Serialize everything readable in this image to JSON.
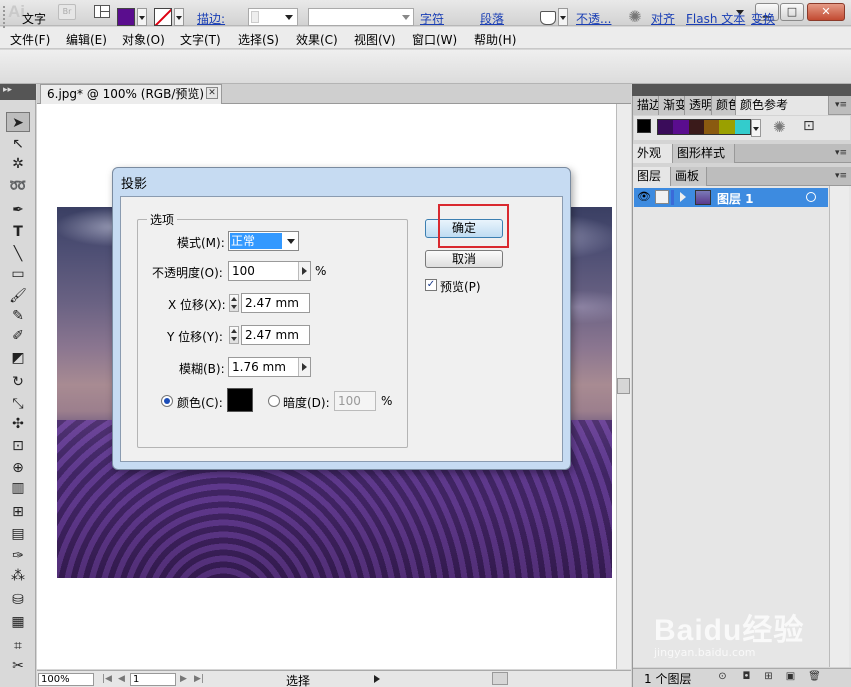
{
  "app": {
    "logo": "Ai",
    "bridge": "Br"
  },
  "window": {
    "minimize": "▁",
    "maximize": "□",
    "close": "✕"
  },
  "menu": [
    "文件(F)",
    "编辑(E)",
    "对象(O)",
    "文字(T)",
    "选择(S)",
    "效果(C)",
    "视图(V)",
    "窗口(W)",
    "帮助(H)"
  ],
  "control_bar": {
    "type_label": "文字",
    "stroke_label": "描边:",
    "fill_color": "#5a0d8e",
    "links": [
      "字符",
      "段落",
      "不透...",
      "对齐",
      "Flash 文本",
      "变换"
    ]
  },
  "document": {
    "tab_title": "6.jpg* @ 100% (RGB/预览)",
    "tab_close": "✕"
  },
  "status_bar": {
    "zoom": "100%",
    "page": "1",
    "status": "选择"
  },
  "right_panel": {
    "tabs_top": [
      "描边",
      "渐变",
      "透明",
      "颜色",
      "颜色参考"
    ],
    "tabs_mid": [
      "外观",
      "图形样式"
    ],
    "tabs_layers": [
      "图层",
      "画板"
    ],
    "swatches": [
      "#3a0c5a",
      "#5a0d8e",
      "#3a1a1a",
      "#8a5a10",
      "#9aa000",
      "#33cccc"
    ],
    "layer_name": "图层 1",
    "layers_count": "1 个图层"
  },
  "dialog": {
    "title": "投影",
    "group_label": "选项",
    "mode_label": "模式(M):",
    "mode_value": "正常",
    "opacity_label": "不透明度(O):",
    "opacity_value": "100",
    "percent": "%",
    "x_offset_label": "X 位移(X):",
    "x_offset_value": "2.47 mm",
    "y_offset_label": "Y 位移(Y):",
    "y_offset_value": "2.47 mm",
    "blur_label": "模糊(B):",
    "blur_value": "1.76 mm",
    "color_label": "颜色(C):",
    "darkness_label": "暗度(D):",
    "darkness_value": "100",
    "ok": "确定",
    "cancel": "取消",
    "preview_label": "预览(P)",
    "preview_checked": "✓",
    "shadow_color": "#000000"
  },
  "watermark": {
    "text": "Baidu经验",
    "sub": "jingyan.baidu.com"
  }
}
